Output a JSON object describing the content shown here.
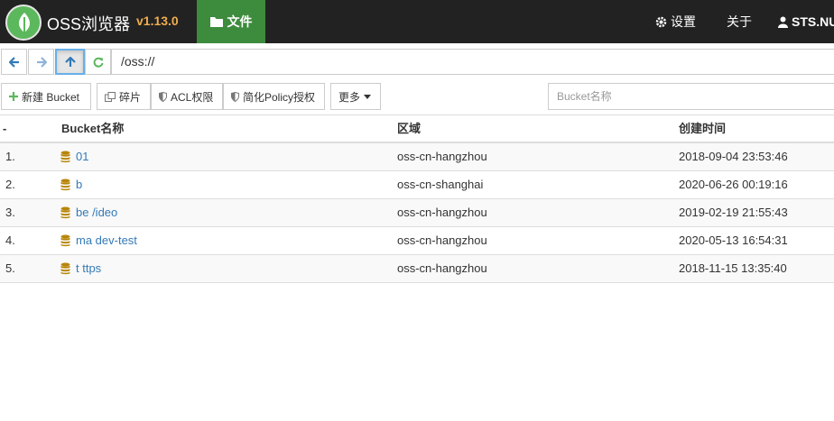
{
  "navbar": {
    "brand": "OSS浏览器",
    "version": "v1.13.0",
    "files_tab": "文件",
    "settings": "设置",
    "about": "关于",
    "user": "STS.NU"
  },
  "address": {
    "path": "/oss://"
  },
  "toolbar": {
    "new_bucket": "新建 Bucket",
    "fragments": "碎片",
    "acl": "ACL权限",
    "policy": "简化Policy授权",
    "more": "更多"
  },
  "search": {
    "placeholder": "Bucket名称"
  },
  "table": {
    "headers": {
      "index": "-",
      "name": "Bucket名称",
      "region": "区域",
      "created": "创建时间"
    },
    "rows": [
      {
        "index": "1.",
        "name": "01",
        "region": "oss-cn-hangzhou",
        "created": "2018-09-04 23:53:46"
      },
      {
        "index": "2.",
        "name": "b",
        "region": "oss-cn-shanghai",
        "created": "2020-06-26 00:19:16"
      },
      {
        "index": "3.",
        "name": "be /ideo",
        "region": "oss-cn-hangzhou",
        "created": "2019-02-19 21:55:43"
      },
      {
        "index": "4.",
        "name": "ma dev-test",
        "region": "oss-cn-hangzhou",
        "created": "2020-05-13 16:54:31"
      },
      {
        "index": "5.",
        "name": "t ttps",
        "region": "oss-cn-hangzhou",
        "created": "2018-11-15 13:35:40"
      }
    ]
  },
  "colors": {
    "navbar_bg": "#222222",
    "active_tab": "#3d8b3d",
    "version": "#f0ad4e",
    "link": "#337ab7",
    "db_icon": "#b8860b"
  }
}
